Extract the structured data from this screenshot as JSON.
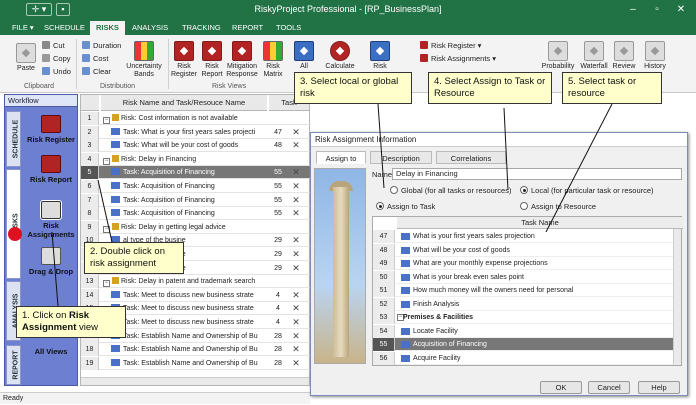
{
  "window": {
    "title": "RiskyProject Professional - [RP_BusinessPlan]",
    "min": "–",
    "max": "▫",
    "close": "✕"
  },
  "tabs": [
    "FILE ▾",
    "SCHEDULE",
    "RISKS",
    "ANALYSIS",
    "TRACKING",
    "REPORT",
    "TOOLS"
  ],
  "ribbon": {
    "clipboard": {
      "paste": "Paste",
      "cut": "Cut",
      "copy": "Copy",
      "undo": "Undo",
      "label": "Clipboard"
    },
    "distribution": {
      "duration": "Duration",
      "cost": "Cost",
      "clear": "Clear",
      "uncertainty": "Uncertainty Bands",
      "label": "Distribution"
    },
    "views": {
      "register": "Risk Register",
      "report": "Risk Report",
      "mitigation": "Mitigation Response",
      "matrix": "Risk Matrix",
      "label": "Risk Views"
    },
    "all": "All",
    "calculate": "Calculate",
    "risk_register_dd": "Risk Register ▾",
    "risk_assignments_dd": "Risk Assignments ▾",
    "risk": "Risk",
    "probability": "Probability",
    "waterfall": "Waterfall",
    "review": "Review",
    "history": "History"
  },
  "workflow": {
    "title": "Workflow",
    "tabs": [
      "SCHEDULE",
      "RISKS",
      "ANALYSIS",
      "REPORT"
    ],
    "items": [
      "Risk Register",
      "Risk Report",
      "Risk Assignments",
      "Drag & Drop",
      "All Views"
    ]
  },
  "grid": {
    "header_name": "Risk Name and Task/Resouce Name",
    "header_task": "Task",
    "rows": [
      {
        "n": "1",
        "text": "Risk: Cost information is not available",
        "v": "",
        "risk": true
      },
      {
        "n": "2",
        "text": "Task: What is your first years sales projecti",
        "v": "47"
      },
      {
        "n": "3",
        "text": "Task: What will be your cost of goods",
        "v": "48"
      },
      {
        "n": "4",
        "text": "Risk: Delay in Financing",
        "v": "",
        "risk": true
      },
      {
        "n": "5",
        "text": "Task: Acquisition of Financing",
        "v": "55",
        "sel": true
      },
      {
        "n": "6",
        "text": "Task: Acquisition of Financing",
        "v": "55"
      },
      {
        "n": "7",
        "text": "Task: Acquisition of Financing",
        "v": "55"
      },
      {
        "n": "8",
        "text": "Task: Acquisition of Financing",
        "v": "55"
      },
      {
        "n": "9",
        "text": "Risk: Delay in getting legal advice",
        "v": "",
        "risk": true
      },
      {
        "n": "10",
        "text": "al type of the busine",
        "v": "29"
      },
      {
        "n": "11",
        "text": "al type of the busine",
        "v": "29"
      },
      {
        "n": "12",
        "text": "al type of the busine",
        "v": "29"
      },
      {
        "n": "13",
        "text": "Risk: Delay in patent and trademark search",
        "v": "",
        "risk": true
      },
      {
        "n": "14",
        "text": "Task: Meet to discuss new business strate",
        "v": "4"
      },
      {
        "n": "15",
        "text": "Task: Meet to discuss new business strate",
        "v": "4"
      },
      {
        "n": "16",
        "text": "Task: Meet to discuss new business strate",
        "v": "4"
      },
      {
        "n": "17",
        "text": "Task: Establish Name and Ownership of Bu",
        "v": "28"
      },
      {
        "n": "18",
        "text": "Task: Establish Name and Ownership of Bu",
        "v": "28"
      },
      {
        "n": "19",
        "text": "Task: Establish Name and Ownership of Bu",
        "v": "28"
      }
    ]
  },
  "dialog": {
    "title": "Risk Assignment Information",
    "tabs": [
      "Assign to",
      "Description",
      "Correlations"
    ],
    "name_label": "Name:",
    "name_value": "Delay in Financing",
    "global_label": "Global (for all tasks or resources)",
    "local_label": "Local (for particular task or resource)",
    "assign_task": "Assign to Task",
    "assign_resource": "Assign to Resource",
    "task_header": "Task Name",
    "tasks": [
      {
        "n": "47",
        "text": "What is your first years sales projection"
      },
      {
        "n": "48",
        "text": "What will be your cost of goods"
      },
      {
        "n": "49",
        "text": "What are your monthly expense projections"
      },
      {
        "n": "50",
        "text": "What is your break even sales point"
      },
      {
        "n": "51",
        "text": "How much money will the owners need for personal"
      },
      {
        "n": "52",
        "text": "Finish Analysis"
      },
      {
        "n": "53",
        "text": "Premises & Facilities",
        "group": true
      },
      {
        "n": "54",
        "text": "Locate Facility"
      },
      {
        "n": "55",
        "text": "Acquisition of Financing",
        "sel": true
      },
      {
        "n": "56",
        "text": "Acquire Facility"
      }
    ],
    "ok": "OK",
    "cancel": "Cancel",
    "help": "Help"
  },
  "callouts": {
    "c1_pre": "1. Click on ",
    "c1_bold": "Risk Assignment",
    "c1_post": " view",
    "c2": "2. Double click on risk assignment",
    "c3": "3. Select local or global risk",
    "c4": "4. Select Assign to Task or Resource",
    "c5": "5. Select task or resource"
  },
  "status": "Ready"
}
